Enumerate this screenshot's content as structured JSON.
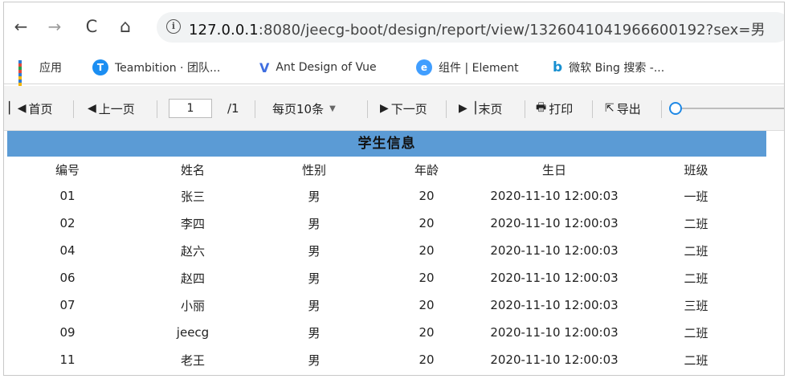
{
  "browser": {
    "back_glyph": "←",
    "forward_glyph": "→",
    "reload_glyph": "C",
    "home_glyph": "⌂",
    "info_glyph": "i",
    "url_host": "127.0.0.1",
    "url_rest": ":8080/jeecg-boot/design/report/view/1326041041966600192?sex=男"
  },
  "bookmarks": [
    {
      "label": "应用",
      "icon": "apps-grid-icon"
    },
    {
      "label": "Teambition · 团队...",
      "icon": "teambition-icon",
      "glyph": "T",
      "color": "#1b8ef2"
    },
    {
      "label": "Ant Design of Vue",
      "icon": "ant-design-vue-icon",
      "glyph": "V",
      "color": "#3f6ee0"
    },
    {
      "label": "组件 | Element",
      "icon": "element-icon",
      "glyph": "e",
      "color": "#409eff"
    },
    {
      "label": "微软 Bing 搜索 -...",
      "icon": "bing-icon",
      "glyph": "b",
      "color": "#178fd0"
    }
  ],
  "toolbar": {
    "first": "首页",
    "prev": "上一页",
    "page_value": "1",
    "page_total": "/1",
    "page_size": "每页10条",
    "next": "下一页",
    "last": "末页",
    "print": "打印",
    "export": "导出",
    "zoom_level": 0
  },
  "report": {
    "title": "学生信息",
    "header_color": "#5b9bd5",
    "columns": [
      "编号",
      "姓名",
      "性别",
      "年龄",
      "生日",
      "班级"
    ],
    "rows": [
      [
        "01",
        "张三",
        "男",
        "20",
        "2020-11-10 12:00:03",
        "一班"
      ],
      [
        "02",
        "李四",
        "男",
        "20",
        "2020-11-10 12:00:03",
        "二班"
      ],
      [
        "04",
        "赵六",
        "男",
        "20",
        "2020-11-10 12:00:03",
        "二班"
      ],
      [
        "06",
        "赵四",
        "男",
        "20",
        "2020-11-10 12:00:03",
        "二班"
      ],
      [
        "07",
        "小丽",
        "男",
        "20",
        "2020-11-10 12:00:03",
        "三班"
      ],
      [
        "09",
        "jeecg",
        "男",
        "20",
        "2020-11-10 12:00:03",
        "二班"
      ],
      [
        "11",
        "老王",
        "男",
        "20",
        "2020-11-10 12:00:03",
        "二班"
      ]
    ]
  }
}
